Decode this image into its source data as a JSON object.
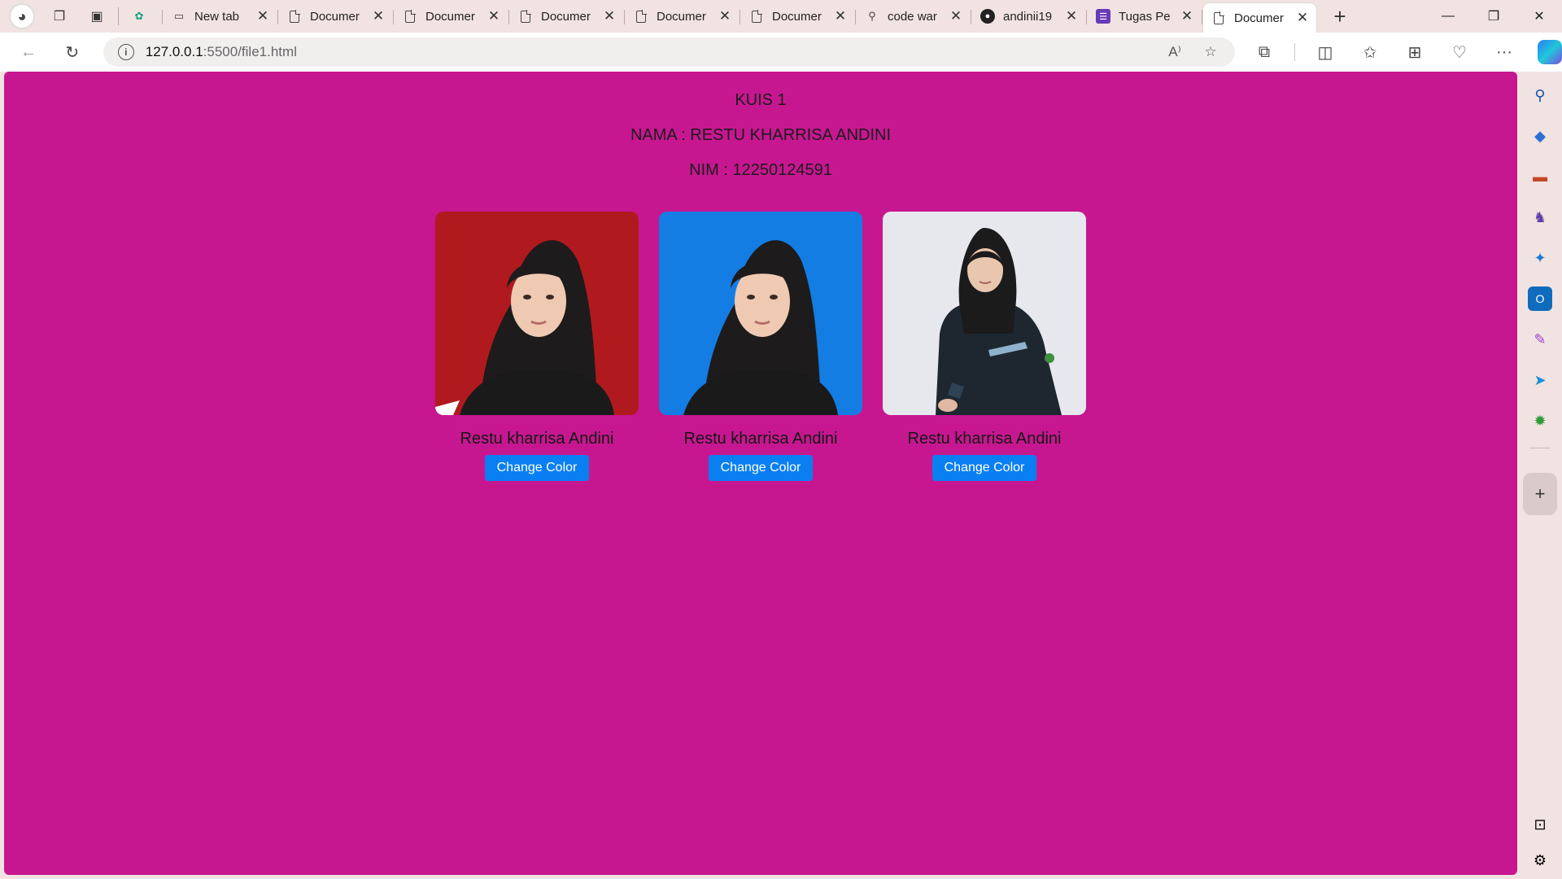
{
  "browser": {
    "tabs": [
      {
        "title": "",
        "icon": "openai-icon"
      },
      {
        "title": "New tab",
        "icon": "newtab-icon"
      },
      {
        "title": "Documer",
        "icon": "document-icon"
      },
      {
        "title": "Documer",
        "icon": "document-icon"
      },
      {
        "title": "Documer",
        "icon": "document-icon"
      },
      {
        "title": "Documer",
        "icon": "document-icon"
      },
      {
        "title": "Documer",
        "icon": "document-icon"
      },
      {
        "title": "code war",
        "icon": "search-icon"
      },
      {
        "title": "andinii19",
        "icon": "github-icon"
      },
      {
        "title": "Tugas Pe",
        "icon": "forms-icon"
      },
      {
        "title": "Documer",
        "icon": "document-icon",
        "active": true
      }
    ],
    "close_glyph": "✕",
    "new_tab_glyph": "+",
    "address": {
      "host": "127.0.0.1",
      "path": ":5500/file1.html"
    }
  },
  "page": {
    "background": "#c71790",
    "heading_kuis": "KUIS 1",
    "heading_nama": "NAMA : RESTU KHARRISA ANDINI",
    "heading_nim": "NIM : 12250124591",
    "cards": [
      {
        "name": "Restu kharrisa Andini",
        "button": "Change Color",
        "photo_bg": "#b01a1e"
      },
      {
        "name": "Restu kharrisa Andini",
        "button": "Change Color",
        "photo_bg": "#137de3"
      },
      {
        "name": "Restu kharrisa Andini",
        "button": "Change Color",
        "photo_bg": "#e6e8ee"
      }
    ],
    "button_color": "#0a7ff2"
  }
}
